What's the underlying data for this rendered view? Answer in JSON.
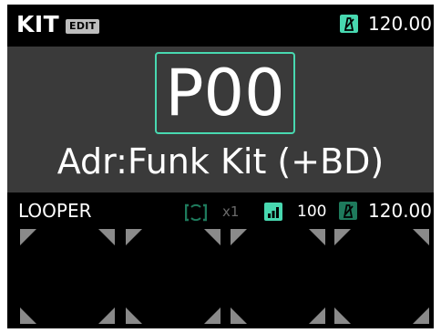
{
  "header": {
    "mode_label": "KIT",
    "edit_badge": "EDIT",
    "tempo": "120.00",
    "metronome_icon": "metronome-icon",
    "accent_color": "#48d8b0"
  },
  "preset": {
    "number": "P00",
    "kit_name": "Adr:Funk Kit (+BD)"
  },
  "looper": {
    "label": "LOOPER",
    "loop_icon": "loop-icon",
    "loop_count": "x1",
    "volume_icon": "volume-bars-icon",
    "volume": "100",
    "metronome_icon": "metronome-icon",
    "tempo": "120.00",
    "pads": [
      {
        "name": "looper-pad-1"
      },
      {
        "name": "looper-pad-2"
      },
      {
        "name": "looper-pad-3"
      },
      {
        "name": "looper-pad-4"
      }
    ]
  },
  "colors": {
    "accent": "#48d8b0",
    "accent_dark": "#1e7a5c",
    "pad_corner": "#8a8a8a",
    "main_bg": "#3a3a3a"
  }
}
